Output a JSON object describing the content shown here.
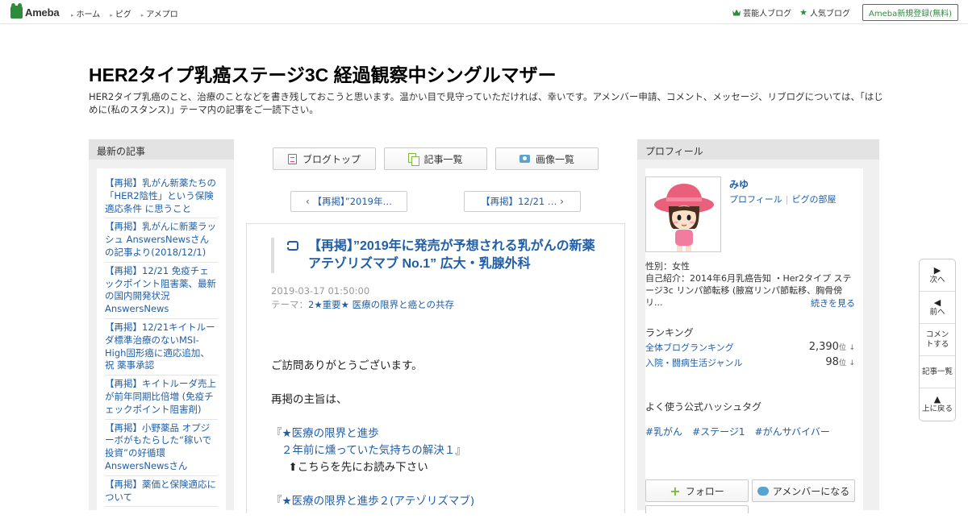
{
  "topbar": {
    "logo_text": "Ameba",
    "nav": [
      "ホーム",
      "ピグ",
      "アメプロ"
    ],
    "right_links": [
      "芸能人ブログ",
      "人気ブログ"
    ],
    "signup": "Ameba新規登録(無料)"
  },
  "blog": {
    "title": "HER2タイプ乳癌ステージ3C 経過観察中シングルマザー",
    "description": "HER2タイプ乳癌のこと、治療のことなどを書き残しておこうと思います。温かい目で見守っていただければ、幸いです。アメンバー申請、コメント、メッセージ、リブログについては、「はじめに(私のスタンス)」テーマ内の記事をご一読下さい。"
  },
  "recent": {
    "heading": "最新の記事",
    "entries": [
      "【再掲】乳がん新薬たちの「HER2陰性」という保険適応条件 に思うこと",
      "【再掲】乳がんに新薬ラッシュ AnswersNewsさんの記事より(2018/12/1)",
      "【再掲】12/21 免疫チェックポイント阻害薬、最新の国内開発状況 AnswersNews",
      "【再掲】12/21キイトルーダ標準治療のないMSI-High固形癌に適応追加、祝 薬事承認",
      "【再掲】キイトルーダ売上が前年同期比倍増 (免疫チェックポイント阻害剤)",
      "【再掲】小野薬品 オプジーボがもたらした“稼いで投資”の好循環 AnswersNewsさん",
      "【再掲】薬価と保険適応について"
    ]
  },
  "toolbar": {
    "blog_top": "ブログトップ",
    "entry_list": "記事一覧",
    "image_list": "画像一覧"
  },
  "pager": {
    "prev": "【再掲】”2019年…",
    "next": "【再掲】12/21 …"
  },
  "article": {
    "title": "【再掲】”2019年に発売が予想される乳がんの新薬 アテゾリズマブ No.1” 広大・乳腺外科",
    "date": "2019-03-17 01:50:00",
    "theme_label": "テーマ：",
    "theme": "2★重要★ 医療の限界と癌との共存",
    "greeting": "ご訪問ありがとうございます。",
    "intro": "再掲の主旨は、",
    "ref1_open": "『",
    "ref1_line1": "★医療の限界と進歩",
    "ref1_line2": "２年前に燻っていた気持ちの解決１",
    "ref1_close": "』",
    "ref1_note": "⬆こちらを先にお読み下さい",
    "ref2_open": "『",
    "ref2_line1": "★医療の限界と進歩２(アテゾリズマブ)"
  },
  "profile": {
    "heading": "プロフィール",
    "name": "みゆ",
    "link_profile": "プロフィール",
    "link_pig": "ピグの部屋",
    "gender": "性別：女性",
    "intro": "自己紹介：2014年6月乳癌告知 ・Her2タイプ ステージ3c リンパ節転移 (腋窩リンパ節転移、胸骨傍リ...",
    "more": "続きを見る",
    "ranking_heading": "ランキング",
    "rankings": [
      {
        "label": "全体ブログランキング",
        "value": "2,390",
        "unit": "位",
        "trend": "↓"
      },
      {
        "label": "入院・闘病生活ジャンル",
        "value": "98",
        "unit": "位",
        "trend": "↓"
      }
    ],
    "hashtag_heading": "よく使う公式ハッシュタグ",
    "hashtags": [
      "#乳がん",
      "#ステージ1",
      "#がんサバイバー"
    ],
    "follow": "フォロー",
    "amember": "アメンバーになる"
  },
  "sidenav": {
    "next": "次へ",
    "prev": "前へ",
    "comment": "コメントする",
    "list": "記事一覧",
    "top": "上に戻る"
  },
  "colors": {
    "brand_green": "#2d8c3c",
    "link_blue": "#1f5ea6"
  }
}
